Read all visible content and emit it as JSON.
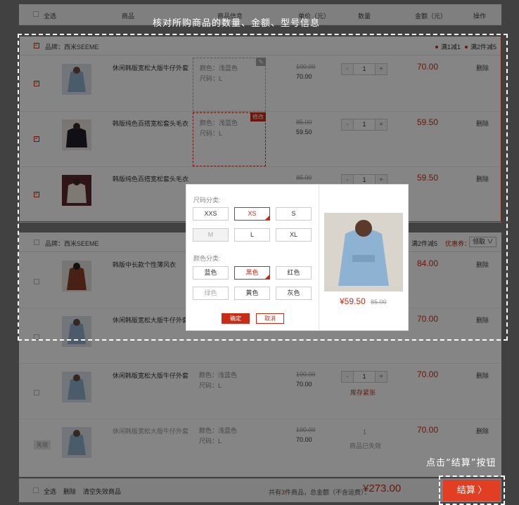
{
  "header": {
    "select_all": "全选",
    "col_product": "商品",
    "col_info": "商品信息",
    "col_price": "单价（元）",
    "col_qty": "数量",
    "col_amount": "金额（元）",
    "col_action": "操作"
  },
  "annotations": {
    "top": "核对所购商品的数量、金额、型号信息",
    "bottom": "点击“结算”按钮"
  },
  "shop1": {
    "brand": "品牌：西米SEEME",
    "promo1": "满1减1",
    "promo2": "满2件减5",
    "edit_badge": "修改",
    "rows": [
      {
        "name": "休闲韩版宽松大版牛仔外套",
        "color": "颜色：浅蓝色",
        "size": "尺码：L",
        "old_price": "100.00",
        "price": "70.00",
        "qty": "1",
        "total": "70.00",
        "delete": "删除",
        "minus": "-",
        "plus": "+"
      },
      {
        "name": "韩版纯色百搭宽松套头毛衣",
        "color": "颜色：浅蓝色",
        "size": "尺码：L",
        "old_price": "85.00",
        "price": "59.50",
        "qty": "1",
        "total": "59.50",
        "delete": "删除",
        "minus": "-",
        "plus": "+"
      },
      {
        "name": "韩版纯色百搭宽松套头毛衣",
        "old_price": "85.00",
        "qty": "1",
        "total": "59.50",
        "delete": "删除",
        "minus": "-",
        "plus": "+"
      }
    ]
  },
  "shop2": {
    "brand": "品牌：西米SEEME",
    "promo": "满2件减5",
    "coupon_label": "优惠券：",
    "coupon_btn": "领取 ∨",
    "rows": [
      {
        "name": "韩版中长款个性薄风衣",
        "total": "84.00",
        "delete": "删除"
      },
      {
        "name": "休闲韩版宽松大版牛仔外套",
        "total": "70.00",
        "delete": "删除"
      },
      {
        "name": "休闲韩版宽松大版牛仔外套",
        "color": "颜色：浅蓝色",
        "size": "尺码：L",
        "old_price": "100.00",
        "price": "70.00",
        "qty": "1",
        "total": "70.00",
        "delete": "删除",
        "stock": "库存紧张",
        "minus": "-",
        "plus": "+"
      },
      {
        "name": "休闲韩版宽松大版牛仔外套",
        "color": "颜色：浅蓝色",
        "size": "尺码：L",
        "old_price": "100.00",
        "price": "70.00",
        "qty": "1",
        "total": "70.00",
        "delete": "删除",
        "invalid_badge": "失效",
        "invalid_text": "商品已失效"
      }
    ]
  },
  "popup": {
    "size_label": "尺码分类:",
    "sizes": [
      "XXS",
      "XS",
      "S",
      "M",
      "L",
      "XL"
    ],
    "color_label": "颜色分类:",
    "colors": [
      "蓝色",
      "黑色",
      "红色",
      "绿色",
      "黄色",
      "灰色"
    ],
    "confirm": "确定",
    "cancel": "取消",
    "price": "¥59.50",
    "old_price": "85.00"
  },
  "footer": {
    "select_all": "全选",
    "delete": "删除",
    "clear_invalid": "清空失效商品",
    "summary_a": "共有",
    "count": "3",
    "summary_b": "件商品，总金额（不含运费）：",
    "total": "¥273.00",
    "checkout": "结算 〉"
  },
  "colors": {
    "accent": "#c92c14",
    "checkout": "#e23e23"
  }
}
